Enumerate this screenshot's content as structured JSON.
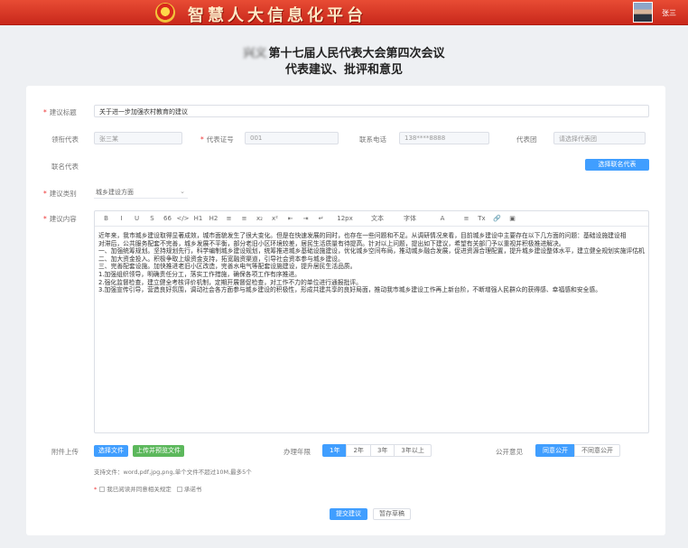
{
  "header": {
    "brand": "智慧人大信息化平台",
    "user_name": "张三"
  },
  "titles": {
    "line1_prefix": "兴义",
    "line1": "第十七届人民代表大会第四次会议",
    "line2": "代表建议、批评和意见"
  },
  "form": {
    "suggestion_title_label": "建议标题",
    "suggestion_title_value": "关于进一步加强农村教育的建议",
    "proposer_label": "领衔代表",
    "proposer_value": "张三某",
    "delegate_no_label": "代表证号",
    "delegate_no_value": "001",
    "phone_label": "联系电话",
    "phone_value": "138****8888",
    "delegation_label": "代表团",
    "delegation_placeholder": "请选择代表团",
    "coproposer_label": "联名代表",
    "coproposer_button": "选择联名代表",
    "category_label": "建议类别",
    "category_value": "城乡建设方面",
    "content_label": "建议内容"
  },
  "editor": {
    "toolbar": [
      "B",
      "I",
      "U",
      "S",
      "66",
      "</>",
      "H1",
      "H2",
      "≡",
      "≡",
      "x₂",
      "x²",
      "⇤",
      "⇥",
      "↵",
      "12px",
      "文本",
      "字体",
      "A",
      "≡",
      "Tx",
      "🔗",
      "▣"
    ],
    "paragraphs": [
      "近年来，我市城乡建设取得显著成效，城市面貌发生了很大变化。但是在快速发展的同时，也存在一些问题和不足。从调研情况来看，目前城乡建设中主要存在以下几方面的问题：基础设施建设相",
      "对滞后，公共服务配套不完善，城乡发展不平衡，部分老旧小区环境较差，居民生活质量有待提高。针对以上问题，提出如下建议，希望有关部门予以重视并积极推进解决。",
      "一、加强统筹规划。坚持规划先行，科学编制城乡建设规划，统筹推进城乡基础设施建设，优化城乡空间布局，推动城乡融合发展，促进资源合理配置，提升城乡建设整体水平，建立健全规划实施评估机制。",
      "二、加大资金投入。积极争取上级资金支持，拓宽融资渠道，引导社会资本参与城乡建设。",
      "三、完善配套设施。加快推进老旧小区改造，完善水电气等配套设施建设，提升居民生活品质。",
      "1.加强组织领导，明确责任分工，落实工作措施，确保各项工作有序推进。",
      "2.强化监督检查，建立健全考核评价机制，定期开展督促检查，对工作不力的单位进行通报批评。",
      "3.加强宣传引导，营造良好氛围，调动社会各方面参与城乡建设的积极性，形成共建共享的良好局面，推动我市城乡建设工作再上新台阶，不断增强人民群众的获得感、幸福感和安全感。"
    ]
  },
  "attachments": {
    "label": "附件上传",
    "upload_button": "选择文件",
    "template_button": "上传并预览文件",
    "hint": "支持文件：word,pdf,jpg,png,单个文件不超过10M,最多5个",
    "agree_text": "我已阅读并同意相关规定",
    "agree_extra": "承诺书"
  },
  "handling": {
    "label": "办理年限",
    "options": [
      "1年",
      "2年",
      "3年",
      "3年以上"
    ],
    "selected": 0
  },
  "disclosure": {
    "label": "公开意见",
    "options": [
      "同意公开",
      "不同意公开"
    ],
    "selected": 0
  },
  "actions": {
    "submit": "提交建议",
    "draft": "暂存草稿"
  }
}
